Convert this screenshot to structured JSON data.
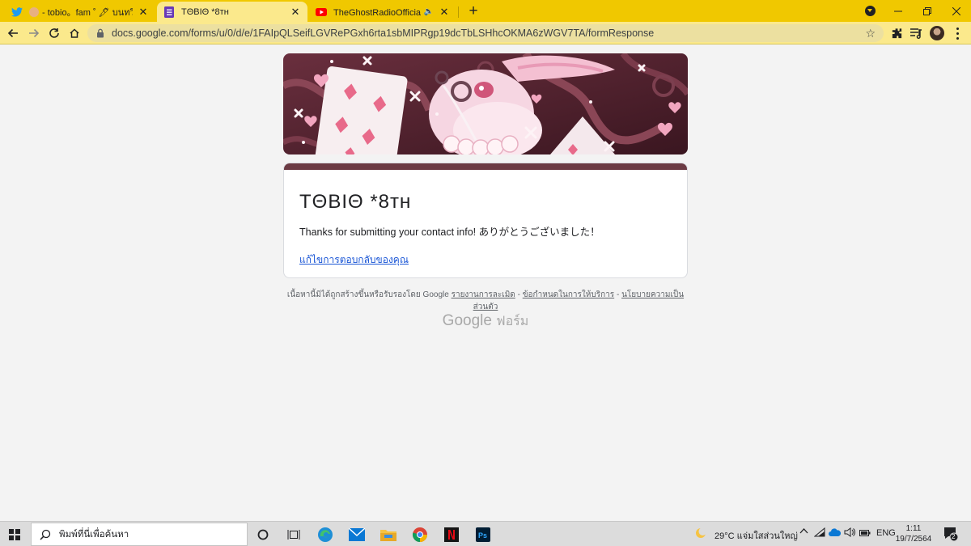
{
  "browser": {
    "tabs": [
      {
        "label": "- tobio。fam ˚ 🖋 บนทวิตเตอร์",
        "icon": "twitter-icon",
        "active": false
      },
      {
        "label": "TΘBIΘ *8ᴛʜ",
        "icon": "google-forms-icon",
        "active": true
      },
      {
        "label": "TheGhostRadioOfficial ฟังเรื่องผี",
        "icon": "youtube-icon",
        "active": false
      }
    ],
    "url": "docs.google.com/forms/u/0/d/e/1FAIpQLSeifLGVRePGxh6rta1sbMIPRgp19dcTbLSHhcOKMA6zWGV7TA/formResponse"
  },
  "form": {
    "title": "TΘBIΘ *8ᴛʜ",
    "confirmation": "Thanks for submitting your contact info! ありがとうございました！",
    "edit_link": "แก้ไขการตอบกลับของคุณ",
    "accent_color": "#6b3a43"
  },
  "footer": {
    "text": "เนื้อหานี้มิได้ถูกสร้างขึ้นหรือรับรองโดย Google",
    "report_link": "รายงานการละเมิด",
    "terms_link": "ข้อกำหนดในการให้บริการ",
    "privacy_link": "นโยบายความเป็นส่วนตัว",
    "sep": "-",
    "brand_google": "Google",
    "brand_forms": "ฟอร์ม"
  },
  "taskbar": {
    "search_placeholder": "พิมพ์ที่นี่เพื่อค้นหา",
    "weather": "29°C  แจ่มใสส่วนใหญ่",
    "language": "ENG",
    "time": "1:11",
    "date": "19/7/2564",
    "notification_count": "2"
  }
}
